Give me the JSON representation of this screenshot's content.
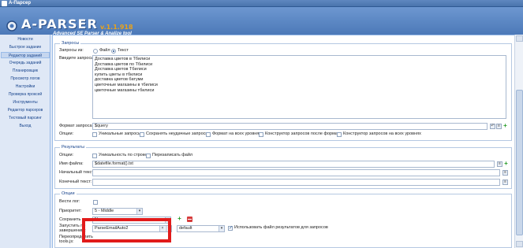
{
  "window": {
    "title": "A-Парсер"
  },
  "logo": {
    "name": "A-PARSER",
    "version": "v.1.1.918",
    "tagline": "Advanced SE Parser & Analize tool"
  },
  "sidebar": {
    "items": [
      {
        "label": "Новости"
      },
      {
        "label": "Быстрое задание"
      },
      {
        "label": "Редактор заданий",
        "active": true
      },
      {
        "label": "Очередь заданий"
      },
      {
        "label": "Планировщик"
      },
      {
        "label": "Просмотр логов"
      },
      {
        "label": "Настройки"
      },
      {
        "label": "Проверка проксей"
      },
      {
        "label": "Инструменты"
      },
      {
        "label": "Редактор парсеров"
      },
      {
        "label": "Тестовый парсинг"
      },
      {
        "label": "Выход"
      }
    ]
  },
  "queries": {
    "legend": "Запросы",
    "source_label": "Запросы из:",
    "source_file": "Файл",
    "source_text": "Текст",
    "enter_label": "Введите запросы:",
    "lines": [
      "Доставка цветов в Тбилиси",
      "Доставка цветов по Тбилиси",
      "Доставка цветов Тбилиси",
      "купить цветы в тбилиси",
      "доставка цветов батуми",
      "цветочные магазины в тбилиси",
      "цветочные магазины тбилиси"
    ],
    "format_label": "Формат запроса:",
    "format_value": "$query",
    "options_label": "Опции:",
    "options": [
      "Уникальные запросы",
      "Сохранять неудачные запросы",
      "Формат на всех уровнях",
      "Конструктор запросов после формата",
      "Конструктор запросов на всех уровнях"
    ]
  },
  "results": {
    "legend": "Результаты",
    "options_label": "Опции:",
    "unique_by_line": "Уникальность по строке",
    "overwrite_file": "Перезаписать файл",
    "filename_label": "Имя файла:",
    "filename_value": "$datefile.format().txt",
    "start_text_label": "Начальный текст:",
    "end_text_label": "Конечный текст:"
  },
  "options": {
    "legend": "Опции",
    "log_label": "Вести лог:",
    "priority_label": "Приоритет:",
    "priority_value": "5 - Middle",
    "save_label": "Сохранить уник:",
    "save_value": "No",
    "run_label": "Запустить по завершению:",
    "run_value": "ParseEmailAuto2",
    "preset_value": "default",
    "use_results_label": "Использовать файл результатов для запросов",
    "redefine_label": "Переопределить tools.js:"
  },
  "colors": {
    "accent": "#4c79b8",
    "highlight": "#e11b1b",
    "add": "#2a9d2a",
    "remove": "#d63b3b"
  }
}
